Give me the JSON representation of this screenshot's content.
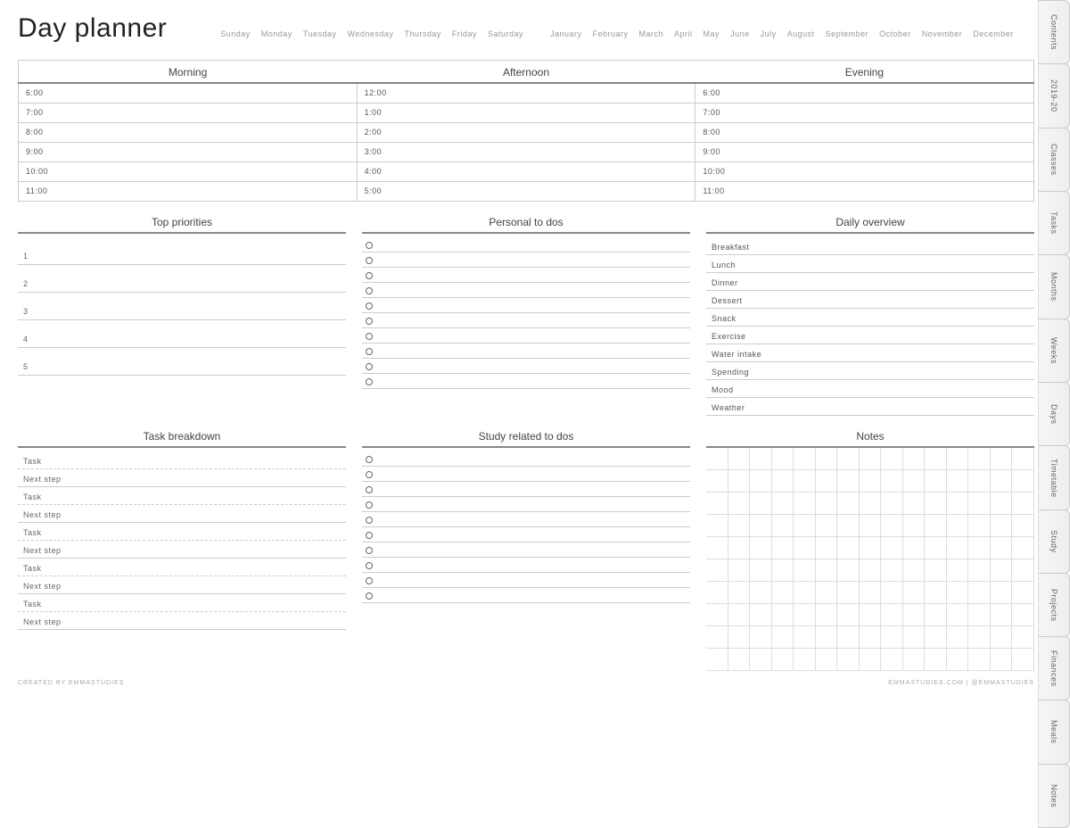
{
  "title": "Day planner",
  "days": [
    "Sunday",
    "Monday",
    "Tuesday",
    "Wednesday",
    "Thursday",
    "Friday",
    "Saturday"
  ],
  "months": [
    "January",
    "February",
    "March",
    "April",
    "May",
    "June",
    "July",
    "August",
    "September",
    "October",
    "November",
    "December"
  ],
  "schedule": {
    "headers": [
      "Morning",
      "Afternoon",
      "Evening"
    ],
    "rows": [
      [
        "6:00",
        "12:00",
        "6:00"
      ],
      [
        "7:00",
        "1:00",
        "7:00"
      ],
      [
        "8:00",
        "2:00",
        "8:00"
      ],
      [
        "9:00",
        "3:00",
        "9:00"
      ],
      [
        "10:00",
        "4:00",
        "10:00"
      ],
      [
        "11:00",
        "5:00",
        "11:00"
      ]
    ]
  },
  "priorities": {
    "title": "Top priorities",
    "items": [
      "1",
      "2",
      "3",
      "4",
      "5"
    ]
  },
  "personal": {
    "title": "Personal to dos",
    "count": 10
  },
  "overview": {
    "title": "Daily overview",
    "items": [
      "Breakfast",
      "Lunch",
      "Dinner",
      "Dessert",
      "Snack",
      "Exercise",
      "Water intake",
      "Spending",
      "Mood",
      "Weather"
    ]
  },
  "breakdown": {
    "title": "Task breakdown",
    "labels": {
      "task": "Task",
      "next": "Next step"
    },
    "pairs": 5
  },
  "study": {
    "title": "Study related to dos",
    "count": 10
  },
  "notes": {
    "title": "Notes",
    "cols": 15,
    "rows": 10
  },
  "footer": {
    "left": "CREATED BY EMMASTUDIES",
    "right": "EMMASTUDIES.COM | @EMMASTUDIES"
  },
  "tabs": [
    "Contents",
    "2019-20",
    "Classes",
    "Tasks",
    "Months",
    "Weeks",
    "Days",
    "Timetable",
    "Study",
    "Projects",
    "Finances",
    "Meals",
    "Notes"
  ]
}
